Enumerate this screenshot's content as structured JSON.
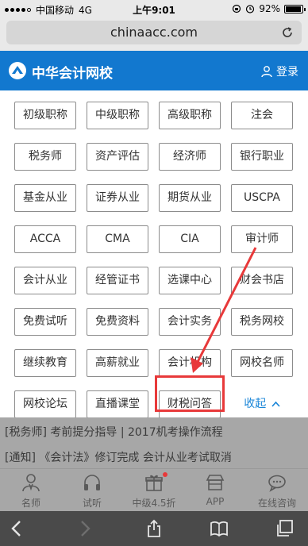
{
  "status": {
    "carrier": "中国移动",
    "network": "4G",
    "time": "上午9:01",
    "battery": "92%"
  },
  "browser": {
    "url": "chinaacc.com"
  },
  "header": {
    "brand": "中华会计网校",
    "login": "登录",
    "background_color": "#1278cf"
  },
  "grid": {
    "items": [
      "初级职称",
      "中级职称",
      "高级职称",
      "注会",
      "税务师",
      "资产评估",
      "经济师",
      "银行职业",
      "基金从业",
      "证券从业",
      "期货从业",
      "USCPA",
      "ACCA",
      "CMA",
      "CIA",
      "审计师",
      "会计从业",
      "经管证书",
      "选课中心",
      "财会书店",
      "免费试听",
      "免费资料",
      "会计实务",
      "税务网校",
      "继续教育",
      "高薪就业",
      "会计机构",
      "网校名师",
      "网校论坛",
      "直播课堂",
      "财税问答"
    ],
    "collapse_label": "收起",
    "collapse_color": "#1a86d8",
    "annotation_color": "#e8393a"
  },
  "news": {
    "line1": "[税务师] 考前提分指导 | 2017机考操作流程",
    "line2": "[通知] 《会计法》修订完成 会计从业考试取消"
  },
  "tabs": [
    {
      "label": "名师",
      "icon": "teacher-icon"
    },
    {
      "label": "试听",
      "icon": "headphones-icon"
    },
    {
      "label": "中级4.5折",
      "icon": "gift-icon"
    },
    {
      "label": "APP",
      "icon": "store-icon"
    },
    {
      "label": "在线咨询",
      "icon": "chat-icon"
    }
  ]
}
